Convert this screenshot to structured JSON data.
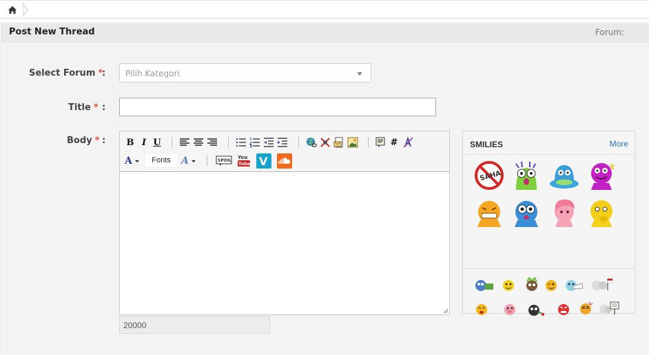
{
  "header": {
    "title": "Post New Thread",
    "forum_label": "Forum:"
  },
  "form": {
    "forum_label": "Select Forum",
    "forum_placeholder": "Pilih Kategori",
    "title_label": "Title",
    "body_label": "Body",
    "required_mark": "*",
    "colon": ":"
  },
  "editor": {
    "bold": "B",
    "italic": "I",
    "underline": "U",
    "fonts_label": "Fonts",
    "hash": "#",
    "char_count": "20000"
  },
  "smilies": {
    "title": "SMILIES",
    "more_label": "More"
  },
  "icons": {
    "home": "home-icon",
    "font_color": "font-color-icon",
    "smilies_big": [
      "no-saha-icon",
      "green-monster-icon",
      "blue-ufo-icon",
      "purple-smiley-icon",
      "yellow-grin-icon",
      "blue-surprised-icon",
      "pink-girl-icon",
      "yellow-thinking-icon"
    ],
    "smilies_small": [
      "blue-peek-icon",
      "yellow-smile-icon",
      "green-hair-icon",
      "wink-icon",
      "mask-icon",
      "flag-icon",
      "tongue-icon",
      "pig-icon",
      "black-bomb-icon",
      "angry-icon",
      "dizzy-icon",
      "sign-icon"
    ]
  },
  "colors": {
    "accent": "#e0523e",
    "link": "#2a6fb5"
  }
}
